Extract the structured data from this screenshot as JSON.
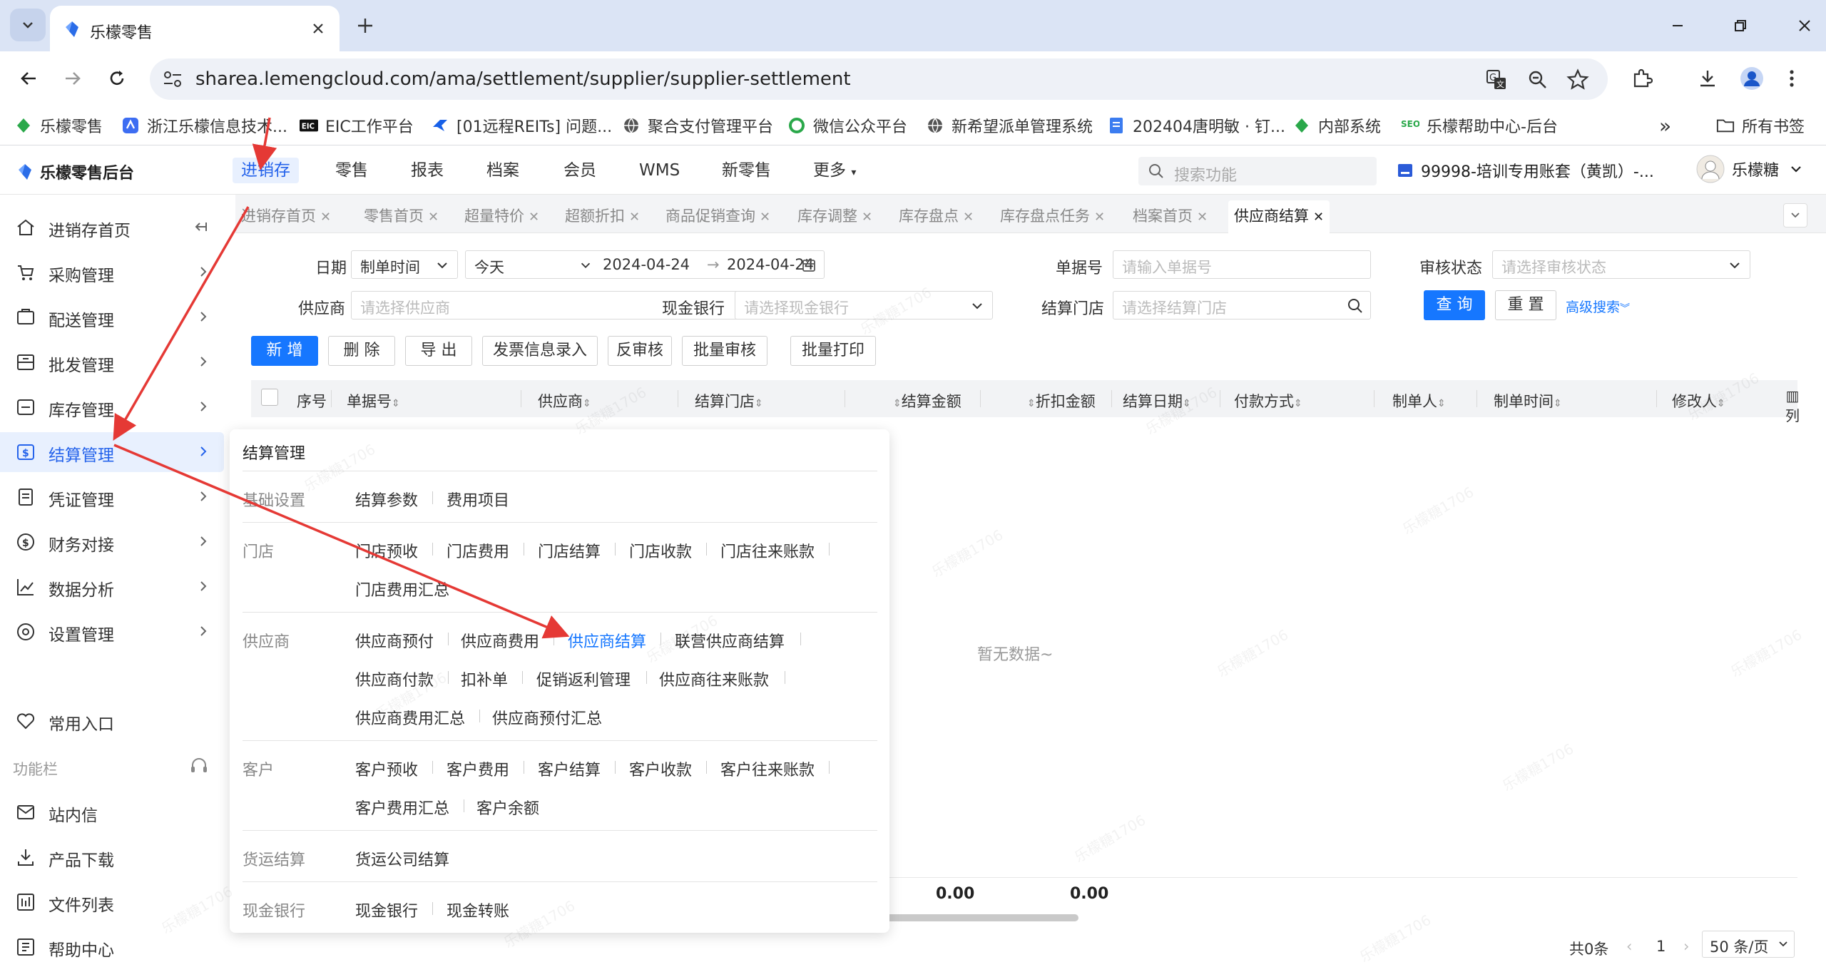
{
  "browser": {
    "tab_title": "乐檬零售",
    "url": "sharea.lemengcloud.com/ama/settlement/supplier/supplier-settlement",
    "bookmarks": [
      {
        "label": "乐檬零售",
        "icon": "lemeng-icon"
      },
      {
        "label": "浙江乐檬信息技术...",
        "icon": "blue-square-icon"
      },
      {
        "label": "EIC工作平台",
        "icon": "eic-icon"
      },
      {
        "label": "[01远程REITs] 问题...",
        "icon": "bird-icon"
      },
      {
        "label": "聚合支付管理平台",
        "icon": "globe-icon"
      },
      {
        "label": "微信公众平台",
        "icon": "green-c-icon"
      },
      {
        "label": "新希望派单管理系统",
        "icon": "globe-icon"
      },
      {
        "label": "202404唐明敏 · 钉...",
        "icon": "doc-icon"
      },
      {
        "label": "内部系统",
        "icon": "lemeng-icon"
      },
      {
        "label": "乐檬帮助中心-后台",
        "icon": "seo-icon"
      }
    ],
    "all_bookmarks": "所有书签",
    "overflow": "»"
  },
  "app": {
    "logo": "乐檬零售后台",
    "nav": [
      "进销存",
      "零售",
      "报表",
      "档案",
      "会员",
      "WMS",
      "新零售",
      "更多"
    ],
    "search_placeholder": "搜索功能",
    "account": "99998-培训专用账套（黄凯）-...",
    "user": "乐檬糖"
  },
  "sidebar": {
    "items": [
      "进销存首页",
      "采购管理",
      "配送管理",
      "批发管理",
      "库存管理",
      "结算管理",
      "凭证管理",
      "财务对接",
      "数据分析",
      "设置管理"
    ],
    "common": "常用入口",
    "section": "功能栏",
    "tools": [
      "站内信",
      "产品下载",
      "文件列表",
      "帮助中心"
    ]
  },
  "page_tabs": [
    "进销存首页",
    "零售首页",
    "超量特价",
    "超额折扣",
    "商品促销查询",
    "库存调整",
    "库存盘点",
    "库存盘点任务",
    "档案首页",
    "供应商结算"
  ],
  "filters": {
    "date_label": "日期",
    "date_type": "制单时间",
    "date_preset": "今天",
    "date_start": "2024-04-24",
    "date_end": "2024-04-24",
    "doc_no_label": "单据号",
    "doc_no_placeholder": "请输入单据号",
    "audit_label": "审核状态",
    "audit_placeholder": "请选择审核状态",
    "supplier_label": "供应商",
    "supplier_placeholder": "请选择供应商",
    "bank_label": "现金银行",
    "bank_placeholder": "请选择现金银行",
    "store_label": "结算门店",
    "store_placeholder": "请选择结算门店",
    "query": "查 询",
    "reset": "重 置",
    "advanced": "高级搜索"
  },
  "actions": [
    "新 增",
    "删 除",
    "导 出",
    "发票信息录入",
    "反审核",
    "批量审核",
    "批量打印"
  ],
  "table": {
    "columns": [
      "序号",
      "单据号",
      "供应商",
      "结算门店",
      "结算金额",
      "折扣金额",
      "结算日期",
      "付款方式",
      "制单人",
      "制单时间",
      "修改人"
    ],
    "col_settings": "列",
    "empty": "暂无数据~",
    "sums": [
      "0.00",
      "0.00"
    ]
  },
  "pagination": {
    "total": "共0条",
    "page": "1",
    "size": "50 条/页"
  },
  "mega_menu": {
    "title": "结算管理",
    "groups": [
      {
        "name": "基础设置",
        "links": [
          "结算参数",
          "费用项目"
        ]
      },
      {
        "name": "门店",
        "links": [
          "门店预收",
          "门店费用",
          "门店结算",
          "门店收款",
          "门店往来账款",
          "门店费用汇总"
        ]
      },
      {
        "name": "供应商",
        "links": [
          "供应商预付",
          "供应商费用",
          "供应商结算",
          "联营供应商结算",
          "供应商付款",
          "扣补单",
          "促销返利管理",
          "供应商往来账款",
          "供应商费用汇总",
          "供应商预付汇总"
        ]
      },
      {
        "name": "客户",
        "links": [
          "客户预收",
          "客户费用",
          "客户结算",
          "客户收款",
          "客户往来账款",
          "客户费用汇总",
          "客户余额"
        ]
      },
      {
        "name": "货运结算",
        "links": [
          "货运公司结算"
        ]
      },
      {
        "name": "现金银行",
        "links": [
          "现金银行",
          "现金转账"
        ]
      }
    ]
  },
  "watermark": "乐檬糖1706",
  "colors": {
    "accent": "#1677ff",
    "annotation": "#e53935",
    "active_bg": "#e8f0fe"
  }
}
